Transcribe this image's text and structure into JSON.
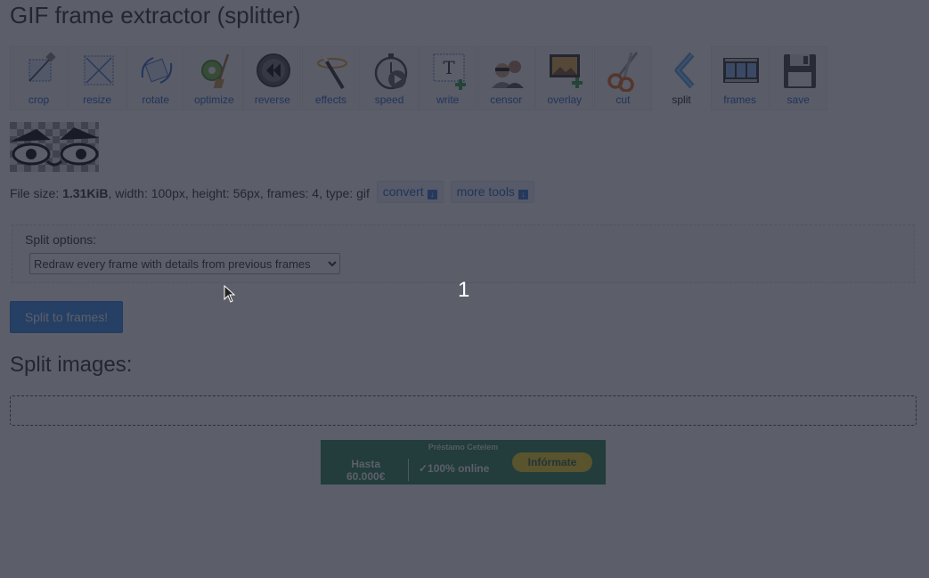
{
  "page": {
    "title": "GIF frame extractor (splitter)"
  },
  "toolbar": {
    "items": [
      {
        "label": "crop",
        "icon": "crop-icon"
      },
      {
        "label": "resize",
        "icon": "resize-icon"
      },
      {
        "label": "rotate",
        "icon": "rotate-icon"
      },
      {
        "label": "optimize",
        "icon": "optimize-icon"
      },
      {
        "label": "reverse",
        "icon": "reverse-icon"
      },
      {
        "label": "effects",
        "icon": "effects-wand-icon"
      },
      {
        "label": "speed",
        "icon": "speed-stopwatch-icon"
      },
      {
        "label": "write",
        "icon": "write-text-icon"
      },
      {
        "label": "censor",
        "icon": "censor-icon"
      },
      {
        "label": "overlay",
        "icon": "overlay-image-icon"
      },
      {
        "label": "cut",
        "icon": "cut-scissors-icon"
      },
      {
        "label": "split",
        "icon": "split-icon",
        "active": true
      },
      {
        "label": "frames",
        "icon": "frames-filmstrip-icon"
      },
      {
        "label": "save",
        "icon": "save-floppy-icon"
      }
    ]
  },
  "file_info": {
    "prefix": "File size: ",
    "size": "1.31KiB",
    "details": ", width: 100px, height: 56px, frames: 4, type: gif",
    "convert_label": "convert",
    "more_tools_label": "more tools"
  },
  "split_options": {
    "label": "Split options:",
    "selected": "Redraw every frame with details from previous frames"
  },
  "overlay_counter": "1",
  "split_button_label": "Split to frames!",
  "split_images_heading": "Split images:",
  "ad": {
    "top": "Préstamo Cetelem",
    "amount_line1": "Hasta",
    "amount_line2": "60.000€",
    "online": "✓100% online",
    "cta": "Infórmate"
  },
  "colors": {
    "link": "#2a6cc4",
    "primary_button": "#3d8fe8",
    "dim_overlay": "rgba(29,32,48,0.72)",
    "ad_background": "#2f8a57",
    "ad_cta": "#f5d629"
  }
}
